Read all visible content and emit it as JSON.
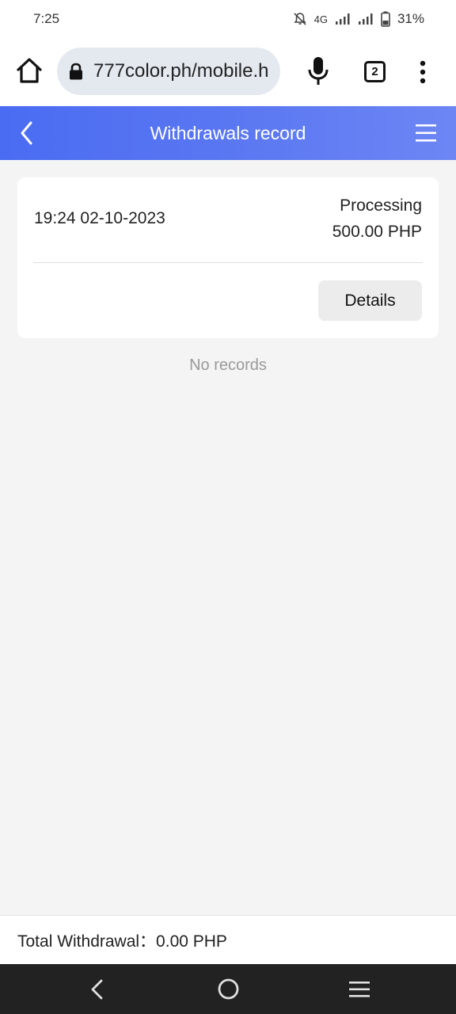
{
  "status_bar": {
    "time": "7:25",
    "network": "4G",
    "battery": "31%"
  },
  "browser": {
    "url": "777color.ph/mobile.h",
    "tab_count": "2"
  },
  "header": {
    "title": "Withdrawals record"
  },
  "record": {
    "datetime": "19:24 02-10-2023",
    "status": "Processing",
    "amount": "500.00 PHP",
    "details_label": "Details"
  },
  "empty_text": "No records",
  "footer": {
    "total_text": "Total Withdrawal：0.00 PHP"
  },
  "colors": {
    "header_gradient_start": "#4a6cf2",
    "header_gradient_end": "#6d86f4",
    "page_background": "#f4f4f5"
  },
  "icons": [
    "home-icon",
    "lock-icon",
    "mic-icon",
    "more-vert-icon",
    "back-arrow-icon",
    "hamburger-menu-icon",
    "nav-back-icon",
    "nav-home-icon",
    "nav-recent-icon"
  ]
}
